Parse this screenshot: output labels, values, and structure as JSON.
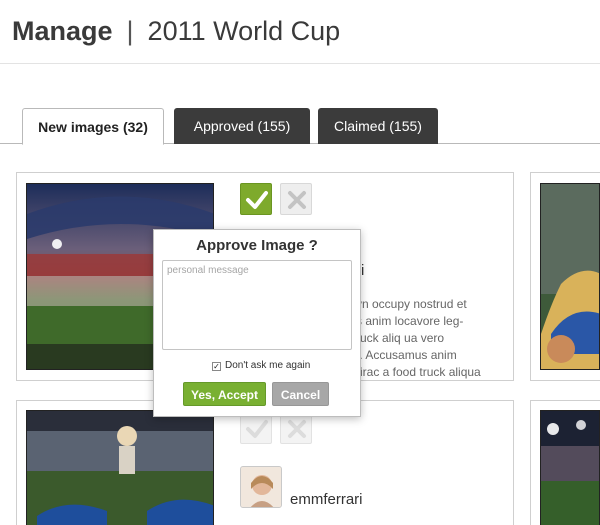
{
  "header": {
    "title_strong": "Manage",
    "separator": "|",
    "title_rest": "2011 World Cup"
  },
  "tabs": [
    {
      "label": "New images (32)"
    },
    {
      "label": "Approved (155)"
    },
    {
      "label": "Claimed (155)"
    }
  ],
  "cards": [
    {
      "username": "ri",
      "description_lines": [
        "yn occupy nostrud et",
        "s anim locavore leg-",
        "ruck aliq ua vero",
        "t. Accusamus anim",
        "rirac a food truck aliqua"
      ]
    },
    {
      "username": "emmferrari"
    }
  ],
  "popup": {
    "title": "Approve Image ?",
    "message_placeholder": "personal message",
    "checkbox_label": "Don't ask me again",
    "checkbox_mark": "✓",
    "accept_label": "Yes, Accept",
    "cancel_label": "Cancel"
  },
  "icons": {
    "accept": "check-icon",
    "reject": "close-icon"
  },
  "colors": {
    "accept": "#7eaa2c",
    "tab_dark": "#3b3b3b",
    "cancel": "#a7a7a7"
  }
}
